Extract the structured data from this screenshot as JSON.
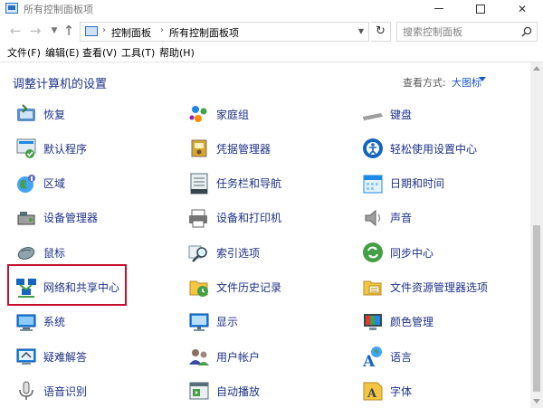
{
  "window": {
    "title": "所有控制面板项"
  },
  "address": {
    "crumbs": [
      "控制面板",
      "所有控制面板项"
    ],
    "search_placeholder": "搜索控制面板"
  },
  "menu": [
    "文件(F)",
    "编辑(E)",
    "查看(V)",
    "工具(T)",
    "帮助(H)"
  ],
  "content": {
    "title": "调整计算机的设置",
    "view_label": "查看方式:",
    "view_value": "大图标"
  },
  "items": [
    {
      "label": "恢复",
      "icon": "recovery-icon",
      "col": 0,
      "row": 0
    },
    {
      "label": "家庭组",
      "icon": "homegroup-icon",
      "col": 1,
      "row": 0
    },
    {
      "label": "键盘",
      "icon": "keyboard-icon",
      "col": 2,
      "row": 0
    },
    {
      "label": "默认程序",
      "icon": "default-programs-icon",
      "col": 0,
      "row": 1
    },
    {
      "label": "凭据管理器",
      "icon": "credential-manager-icon",
      "col": 1,
      "row": 1
    },
    {
      "label": "轻松使用设置中心",
      "icon": "ease-of-access-icon",
      "col": 2,
      "row": 1
    },
    {
      "label": "区域",
      "icon": "region-icon",
      "col": 0,
      "row": 2
    },
    {
      "label": "任务栏和导航",
      "icon": "taskbar-icon",
      "col": 1,
      "row": 2
    },
    {
      "label": "日期和时间",
      "icon": "date-time-icon",
      "col": 2,
      "row": 2
    },
    {
      "label": "设备管理器",
      "icon": "device-manager-icon",
      "col": 0,
      "row": 3
    },
    {
      "label": "设备和打印机",
      "icon": "devices-printers-icon",
      "col": 1,
      "row": 3
    },
    {
      "label": "声音",
      "icon": "sound-icon",
      "col": 2,
      "row": 3
    },
    {
      "label": "鼠标",
      "icon": "mouse-icon",
      "col": 0,
      "row": 4
    },
    {
      "label": "索引选项",
      "icon": "indexing-icon",
      "col": 1,
      "row": 4
    },
    {
      "label": "同步中心",
      "icon": "sync-center-icon",
      "col": 2,
      "row": 4
    },
    {
      "label": "网络和共享中心",
      "icon": "network-sharing-icon",
      "col": 0,
      "row": 5
    },
    {
      "label": "文件历史记录",
      "icon": "file-history-icon",
      "col": 1,
      "row": 5
    },
    {
      "label": "文件资源管理器选项",
      "icon": "explorer-options-icon",
      "col": 2,
      "row": 5
    },
    {
      "label": "系统",
      "icon": "system-icon",
      "col": 0,
      "row": 6
    },
    {
      "label": "显示",
      "icon": "display-icon",
      "col": 1,
      "row": 6
    },
    {
      "label": "颜色管理",
      "icon": "color-management-icon",
      "col": 2,
      "row": 6
    },
    {
      "label": "疑难解答",
      "icon": "troubleshooting-icon",
      "col": 0,
      "row": 7
    },
    {
      "label": "用户帐户",
      "icon": "user-accounts-icon",
      "col": 1,
      "row": 7
    },
    {
      "label": "语言",
      "icon": "language-icon",
      "col": 2,
      "row": 7
    },
    {
      "label": "语音识别",
      "icon": "speech-recognition-icon",
      "col": 0,
      "row": 8
    },
    {
      "label": "自动播放",
      "icon": "autoplay-icon",
      "col": 1,
      "row": 8
    },
    {
      "label": "字体",
      "icon": "fonts-icon",
      "col": 2,
      "row": 8
    }
  ]
}
